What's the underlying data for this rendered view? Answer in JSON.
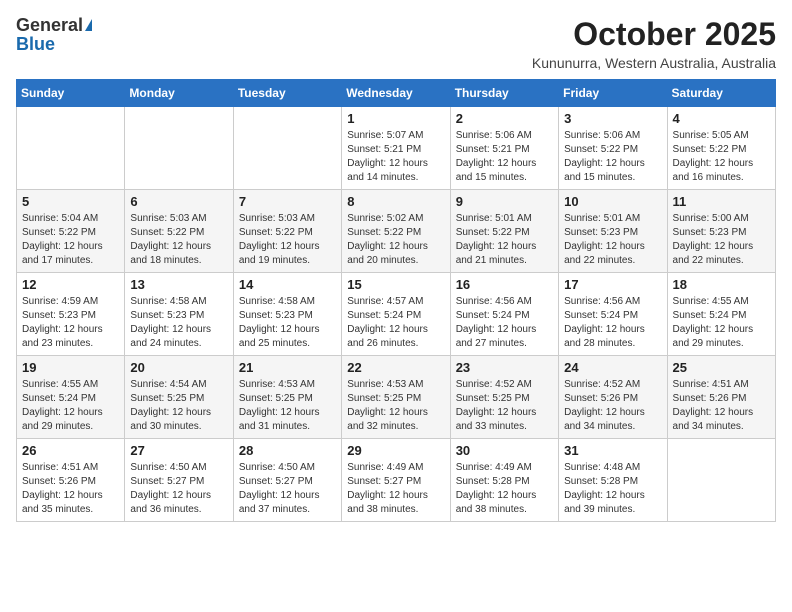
{
  "logo": {
    "general": "General",
    "blue": "Blue"
  },
  "title": "October 2025",
  "location": "Kununurra, Western Australia, Australia",
  "days_of_week": [
    "Sunday",
    "Monday",
    "Tuesday",
    "Wednesday",
    "Thursday",
    "Friday",
    "Saturday"
  ],
  "weeks": [
    [
      {
        "day": "",
        "sunrise": "",
        "sunset": "",
        "daylight": ""
      },
      {
        "day": "",
        "sunrise": "",
        "sunset": "",
        "daylight": ""
      },
      {
        "day": "",
        "sunrise": "",
        "sunset": "",
        "daylight": ""
      },
      {
        "day": "1",
        "sunrise": "Sunrise: 5:07 AM",
        "sunset": "Sunset: 5:21 PM",
        "daylight": "Daylight: 12 hours and 14 minutes."
      },
      {
        "day": "2",
        "sunrise": "Sunrise: 5:06 AM",
        "sunset": "Sunset: 5:21 PM",
        "daylight": "Daylight: 12 hours and 15 minutes."
      },
      {
        "day": "3",
        "sunrise": "Sunrise: 5:06 AM",
        "sunset": "Sunset: 5:22 PM",
        "daylight": "Daylight: 12 hours and 15 minutes."
      },
      {
        "day": "4",
        "sunrise": "Sunrise: 5:05 AM",
        "sunset": "Sunset: 5:22 PM",
        "daylight": "Daylight: 12 hours and 16 minutes."
      }
    ],
    [
      {
        "day": "5",
        "sunrise": "Sunrise: 5:04 AM",
        "sunset": "Sunset: 5:22 PM",
        "daylight": "Daylight: 12 hours and 17 minutes."
      },
      {
        "day": "6",
        "sunrise": "Sunrise: 5:03 AM",
        "sunset": "Sunset: 5:22 PM",
        "daylight": "Daylight: 12 hours and 18 minutes."
      },
      {
        "day": "7",
        "sunrise": "Sunrise: 5:03 AM",
        "sunset": "Sunset: 5:22 PM",
        "daylight": "Daylight: 12 hours and 19 minutes."
      },
      {
        "day": "8",
        "sunrise": "Sunrise: 5:02 AM",
        "sunset": "Sunset: 5:22 PM",
        "daylight": "Daylight: 12 hours and 20 minutes."
      },
      {
        "day": "9",
        "sunrise": "Sunrise: 5:01 AM",
        "sunset": "Sunset: 5:22 PM",
        "daylight": "Daylight: 12 hours and 21 minutes."
      },
      {
        "day": "10",
        "sunrise": "Sunrise: 5:01 AM",
        "sunset": "Sunset: 5:23 PM",
        "daylight": "Daylight: 12 hours and 22 minutes."
      },
      {
        "day": "11",
        "sunrise": "Sunrise: 5:00 AM",
        "sunset": "Sunset: 5:23 PM",
        "daylight": "Daylight: 12 hours and 22 minutes."
      }
    ],
    [
      {
        "day": "12",
        "sunrise": "Sunrise: 4:59 AM",
        "sunset": "Sunset: 5:23 PM",
        "daylight": "Daylight: 12 hours and 23 minutes."
      },
      {
        "day": "13",
        "sunrise": "Sunrise: 4:58 AM",
        "sunset": "Sunset: 5:23 PM",
        "daylight": "Daylight: 12 hours and 24 minutes."
      },
      {
        "day": "14",
        "sunrise": "Sunrise: 4:58 AM",
        "sunset": "Sunset: 5:23 PM",
        "daylight": "Daylight: 12 hours and 25 minutes."
      },
      {
        "day": "15",
        "sunrise": "Sunrise: 4:57 AM",
        "sunset": "Sunset: 5:24 PM",
        "daylight": "Daylight: 12 hours and 26 minutes."
      },
      {
        "day": "16",
        "sunrise": "Sunrise: 4:56 AM",
        "sunset": "Sunset: 5:24 PM",
        "daylight": "Daylight: 12 hours and 27 minutes."
      },
      {
        "day": "17",
        "sunrise": "Sunrise: 4:56 AM",
        "sunset": "Sunset: 5:24 PM",
        "daylight": "Daylight: 12 hours and 28 minutes."
      },
      {
        "day": "18",
        "sunrise": "Sunrise: 4:55 AM",
        "sunset": "Sunset: 5:24 PM",
        "daylight": "Daylight: 12 hours and 29 minutes."
      }
    ],
    [
      {
        "day": "19",
        "sunrise": "Sunrise: 4:55 AM",
        "sunset": "Sunset: 5:24 PM",
        "daylight": "Daylight: 12 hours and 29 minutes."
      },
      {
        "day": "20",
        "sunrise": "Sunrise: 4:54 AM",
        "sunset": "Sunset: 5:25 PM",
        "daylight": "Daylight: 12 hours and 30 minutes."
      },
      {
        "day": "21",
        "sunrise": "Sunrise: 4:53 AM",
        "sunset": "Sunset: 5:25 PM",
        "daylight": "Daylight: 12 hours and 31 minutes."
      },
      {
        "day": "22",
        "sunrise": "Sunrise: 4:53 AM",
        "sunset": "Sunset: 5:25 PM",
        "daylight": "Daylight: 12 hours and 32 minutes."
      },
      {
        "day": "23",
        "sunrise": "Sunrise: 4:52 AM",
        "sunset": "Sunset: 5:25 PM",
        "daylight": "Daylight: 12 hours and 33 minutes."
      },
      {
        "day": "24",
        "sunrise": "Sunrise: 4:52 AM",
        "sunset": "Sunset: 5:26 PM",
        "daylight": "Daylight: 12 hours and 34 minutes."
      },
      {
        "day": "25",
        "sunrise": "Sunrise: 4:51 AM",
        "sunset": "Sunset: 5:26 PM",
        "daylight": "Daylight: 12 hours and 34 minutes."
      }
    ],
    [
      {
        "day": "26",
        "sunrise": "Sunrise: 4:51 AM",
        "sunset": "Sunset: 5:26 PM",
        "daylight": "Daylight: 12 hours and 35 minutes."
      },
      {
        "day": "27",
        "sunrise": "Sunrise: 4:50 AM",
        "sunset": "Sunset: 5:27 PM",
        "daylight": "Daylight: 12 hours and 36 minutes."
      },
      {
        "day": "28",
        "sunrise": "Sunrise: 4:50 AM",
        "sunset": "Sunset: 5:27 PM",
        "daylight": "Daylight: 12 hours and 37 minutes."
      },
      {
        "day": "29",
        "sunrise": "Sunrise: 4:49 AM",
        "sunset": "Sunset: 5:27 PM",
        "daylight": "Daylight: 12 hours and 38 minutes."
      },
      {
        "day": "30",
        "sunrise": "Sunrise: 4:49 AM",
        "sunset": "Sunset: 5:28 PM",
        "daylight": "Daylight: 12 hours and 38 minutes."
      },
      {
        "day": "31",
        "sunrise": "Sunrise: 4:48 AM",
        "sunset": "Sunset: 5:28 PM",
        "daylight": "Daylight: 12 hours and 39 minutes."
      },
      {
        "day": "",
        "sunrise": "",
        "sunset": "",
        "daylight": ""
      }
    ]
  ]
}
